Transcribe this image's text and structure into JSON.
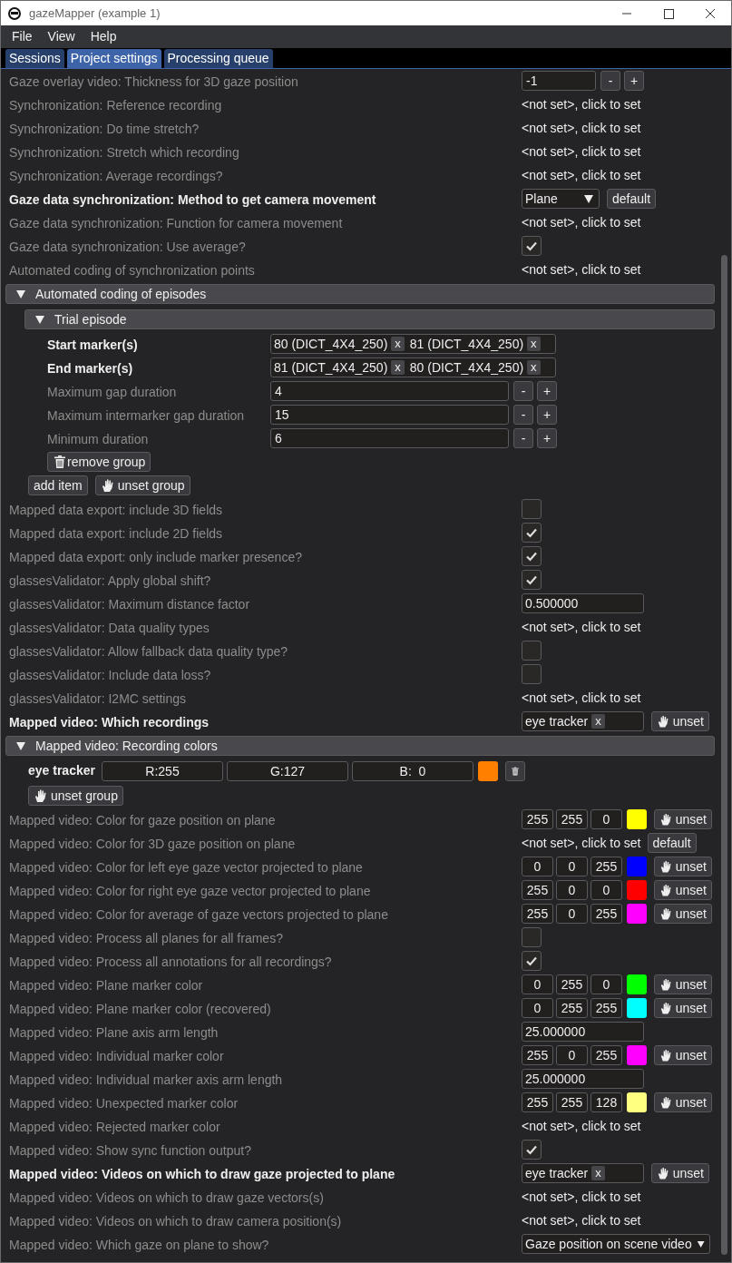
{
  "window": {
    "title": "gazeMapper (example 1)"
  },
  "menu": [
    "File",
    "View",
    "Help"
  ],
  "tabs": [
    {
      "label": "Sessions",
      "selected": false
    },
    {
      "label": "Project settings",
      "selected": true
    },
    {
      "label": "Processing queue",
      "selected": false
    }
  ],
  "settings": [
    {
      "kind": "spin",
      "label": "Gaze overlay video: Thickness for 3D gaze position",
      "set": false,
      "value": "-1",
      "minus": "-",
      "plus": "+"
    },
    {
      "kind": "notset",
      "label": "Synchronization: Reference recording",
      "set": false,
      "value": "<not set>, click to set"
    },
    {
      "kind": "notset",
      "label": "Synchronization: Do time stretch?",
      "set": false,
      "value": "<not set>, click to set"
    },
    {
      "kind": "notset",
      "label": "Synchronization: Stretch which recording",
      "set": false,
      "value": "<not set>, click to set"
    },
    {
      "kind": "notset",
      "label": "Synchronization: Average recordings?",
      "set": false,
      "value": "<not set>, click to set"
    },
    {
      "kind": "combo",
      "label": "Gaze data synchronization: Method to get camera movement",
      "set": true,
      "value": "Plane",
      "button": "default"
    },
    {
      "kind": "notset",
      "label": "Gaze data synchronization: Function for camera movement",
      "set": false,
      "value": "<not set>, click to set"
    },
    {
      "kind": "check",
      "label": "Gaze data synchronization: Use average?",
      "set": false,
      "checked": true
    },
    {
      "kind": "notset",
      "label": "Automated coding of synchronization points",
      "set": false,
      "value": "<not set>, click to set"
    },
    {
      "kind": "group",
      "title": "Automated coding of episodes",
      "expanded": true,
      "children": [
        {
          "kind": "group",
          "title": "Trial episode",
          "expanded": true,
          "children": [
            {
              "kind": "tags",
              "label": "Start marker(s)",
              "set": true,
              "tags": [
                {
                  "label": "80 (DICT_4X4_250)",
                  "remove": "x"
                },
                {
                  "label": "81 (DICT_4X4_250)",
                  "remove": "x"
                }
              ]
            },
            {
              "kind": "tags",
              "label": "End marker(s)",
              "set": true,
              "tags": [
                {
                  "label": "81 (DICT_4X4_250)",
                  "remove": "x"
                },
                {
                  "label": "80 (DICT_4X4_250)",
                  "remove": "x"
                }
              ]
            },
            {
              "kind": "spin",
              "label": "Maximum gap duration",
              "set": false,
              "value": "4",
              "minus": "-",
              "plus": "+"
            },
            {
              "kind": "spin",
              "label": "Maximum intermarker gap duration",
              "set": false,
              "value": "15",
              "minus": "-",
              "plus": "+"
            },
            {
              "kind": "spin",
              "label": "Minimum duration",
              "set": false,
              "value": "6",
              "minus": "-",
              "plus": "+"
            },
            {
              "kind": "buttons",
              "items": [
                {
                  "kind": "remove",
                  "label": "remove group"
                }
              ]
            }
          ]
        },
        {
          "kind": "buttons",
          "items": [
            {
              "kind": "plain",
              "label": "add item"
            },
            {
              "kind": "unset",
              "label": "unset group"
            }
          ]
        }
      ]
    },
    {
      "kind": "check",
      "label": "Mapped data export: include 3D fields",
      "set": false,
      "checked": false
    },
    {
      "kind": "check",
      "label": "Mapped data export: include 2D fields",
      "set": false,
      "checked": true
    },
    {
      "kind": "check",
      "label": "Mapped data export: only include marker presence?",
      "set": false,
      "checked": true
    },
    {
      "kind": "check",
      "label": "glassesValidator: Apply global shift?",
      "set": false,
      "checked": true
    },
    {
      "kind": "text",
      "label": "glassesValidator: Maximum distance factor",
      "set": false,
      "value": "0.500000"
    },
    {
      "kind": "notset",
      "label": "glassesValidator: Data quality types",
      "set": false,
      "value": "<not set>, click to set"
    },
    {
      "kind": "check",
      "label": "glassesValidator: Allow fallback data quality type?",
      "set": false,
      "checked": false
    },
    {
      "kind": "check",
      "label": "glassesValidator: Include data loss?",
      "set": false,
      "checked": false
    },
    {
      "kind": "notset",
      "label": "glassesValidator: I2MC settings",
      "set": false,
      "value": "<not set>, click to set"
    },
    {
      "kind": "tags",
      "label": "Mapped video: Which recordings",
      "set": true,
      "tags": [
        {
          "label": "eye tracker",
          "remove": "x"
        }
      ],
      "button": "unset"
    },
    {
      "kind": "group",
      "title": "Mapped video: Recording colors",
      "expanded": true,
      "children": [
        {
          "kind": "recording_color",
          "label": "eye tracker",
          "fields": [
            "R:255",
            "G:127",
            "B:  0"
          ],
          "color": "#ff7f00"
        },
        {
          "kind": "buttons",
          "items": [
            {
              "kind": "unset",
              "label": "unset group"
            }
          ]
        }
      ]
    },
    {
      "kind": "color",
      "label": "Mapped video: Color for gaze position on plane",
      "set": false,
      "fields": [
        "255",
        "255",
        "0"
      ],
      "color": "#ffff00",
      "button": "unset"
    },
    {
      "kind": "notset",
      "label": "Mapped video: Color for 3D gaze position on plane",
      "set": false,
      "value": "<not set>, click to set",
      "button": "default"
    },
    {
      "kind": "color",
      "label": "Mapped video: Color for left eye gaze vector projected to plane",
      "set": false,
      "fields": [
        "0",
        "0",
        "255"
      ],
      "color": "#0000ff",
      "button": "unset"
    },
    {
      "kind": "color",
      "label": "Mapped video: Color for right eye gaze vector projected to plane",
      "set": false,
      "fields": [
        "255",
        "0",
        "0"
      ],
      "color": "#ff0000",
      "button": "unset"
    },
    {
      "kind": "color",
      "label": "Mapped video: Color for average of gaze vectors projected to plane",
      "set": false,
      "fields": [
        "255",
        "0",
        "255"
      ],
      "color": "#ff00ff",
      "button": "unset"
    },
    {
      "kind": "check",
      "label": "Mapped video: Process all planes for all frames?",
      "set": false,
      "checked": false
    },
    {
      "kind": "check",
      "label": "Mapped video: Process all annotations for all recordings?",
      "set": false,
      "checked": true
    },
    {
      "kind": "color",
      "label": "Mapped video: Plane marker color",
      "set": false,
      "fields": [
        "0",
        "255",
        "0"
      ],
      "color": "#00ff00",
      "button": "unset"
    },
    {
      "kind": "color",
      "label": "Mapped video: Plane marker color (recovered)",
      "set": false,
      "fields": [
        "0",
        "255",
        "255"
      ],
      "color": "#00ffff",
      "button": "unset"
    },
    {
      "kind": "text",
      "label": "Mapped video: Plane axis arm length",
      "set": false,
      "value": "25.000000"
    },
    {
      "kind": "color",
      "label": "Mapped video: Individual marker color",
      "set": false,
      "fields": [
        "255",
        "0",
        "255"
      ],
      "color": "#ff00ff",
      "button": "unset"
    },
    {
      "kind": "text",
      "label": "Mapped video: Individual marker axis arm length",
      "set": false,
      "value": "25.000000"
    },
    {
      "kind": "color",
      "label": "Mapped video: Unexpected marker color",
      "set": false,
      "fields": [
        "255",
        "255",
        "128"
      ],
      "color": "#ffff80",
      "button": "unset"
    },
    {
      "kind": "notset",
      "label": "Mapped video: Rejected marker color",
      "set": false,
      "value": "<not set>, click to set"
    },
    {
      "kind": "check",
      "label": "Mapped video: Show sync function output?",
      "set": false,
      "checked": true
    },
    {
      "kind": "tags",
      "label": "Mapped video: Videos on which to draw gaze projected to plane",
      "set": true,
      "tags": [
        {
          "label": "eye tracker",
          "remove": "x"
        }
      ],
      "button": "unset"
    },
    {
      "kind": "notset",
      "label": "Mapped video: Videos on which to draw gaze vectors(s)",
      "set": false,
      "value": "<not set>, click to set"
    },
    {
      "kind": "notset",
      "label": "Mapped video: Videos on which to draw camera position(s)",
      "set": false,
      "value": "<not set>, click to set"
    },
    {
      "kind": "combo",
      "label": "Mapped video: Which gaze on plane to show?",
      "set": false,
      "value": "Gaze position on scene video"
    }
  ]
}
